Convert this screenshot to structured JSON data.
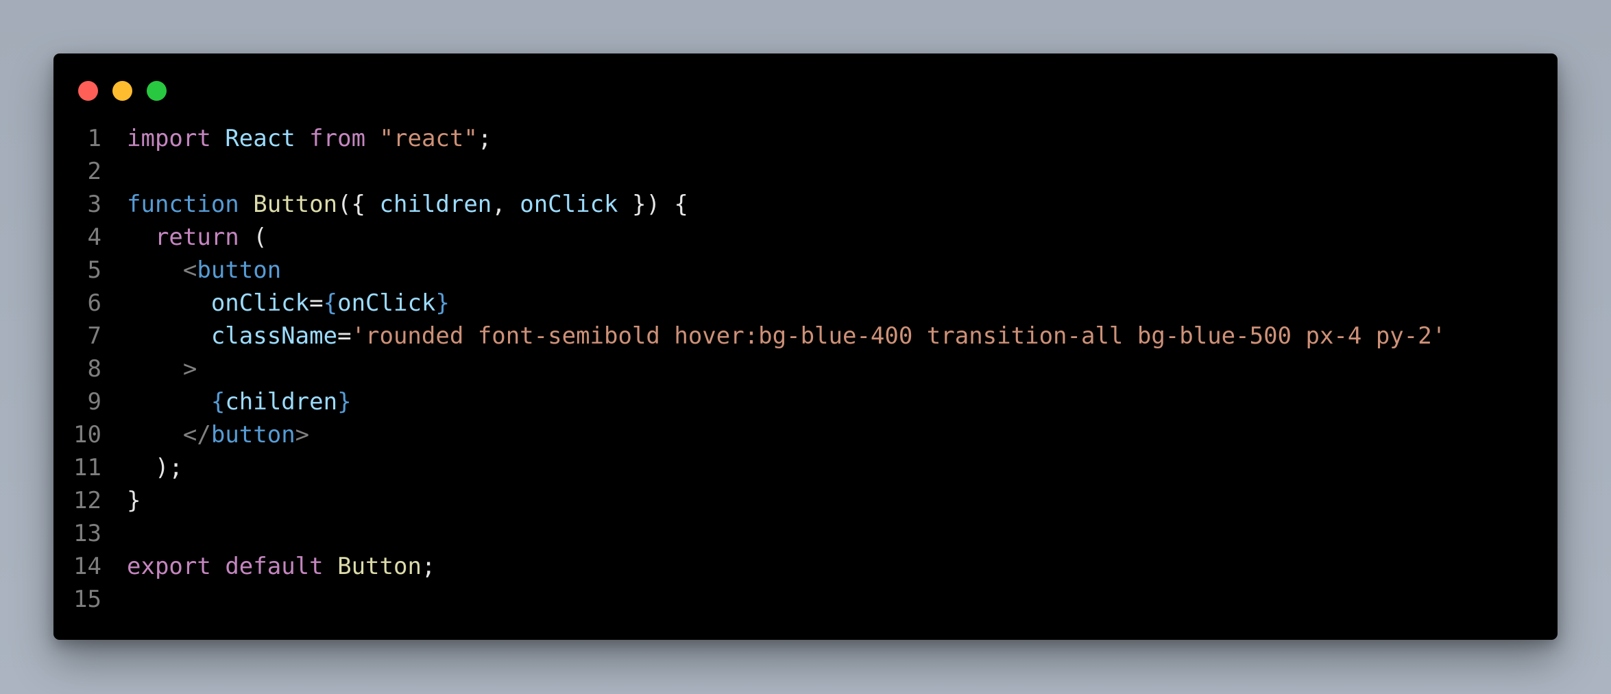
{
  "window": {
    "controls": [
      {
        "name": "close",
        "color": "#ff5f57"
      },
      {
        "name": "minimize",
        "color": "#febc2e"
      },
      {
        "name": "maximize",
        "color": "#28c840"
      }
    ]
  },
  "theme": {
    "background": "#000000",
    "plain": "#e6e6e6",
    "line_number": "#7e7e7e",
    "keyword": "#c586c0",
    "storage": "#569cd6",
    "function_name": "#dcdcaa",
    "variable": "#9cdcfe",
    "string": "#ce9178",
    "tag": "#569cd6",
    "punctuation_dim": "#808080"
  },
  "code_lines": [
    {
      "number": "1",
      "tokens": [
        {
          "text": "import",
          "kind": "keyword"
        },
        {
          "text": " ",
          "kind": "plain"
        },
        {
          "text": "React",
          "kind": "variable"
        },
        {
          "text": " ",
          "kind": "plain"
        },
        {
          "text": "from",
          "kind": "keyword"
        },
        {
          "text": " ",
          "kind": "plain"
        },
        {
          "text": "\"react\"",
          "kind": "string"
        },
        {
          "text": ";",
          "kind": "plain"
        }
      ]
    },
    {
      "number": "2",
      "tokens": []
    },
    {
      "number": "3",
      "tokens": [
        {
          "text": "function",
          "kind": "storage"
        },
        {
          "text": " ",
          "kind": "plain"
        },
        {
          "text": "Button",
          "kind": "function_name"
        },
        {
          "text": "({ ",
          "kind": "plain"
        },
        {
          "text": "children",
          "kind": "variable"
        },
        {
          "text": ", ",
          "kind": "plain"
        },
        {
          "text": "onClick",
          "kind": "variable"
        },
        {
          "text": " }) {",
          "kind": "plain"
        }
      ]
    },
    {
      "number": "4",
      "tokens": [
        {
          "text": "  ",
          "kind": "plain"
        },
        {
          "text": "return",
          "kind": "keyword"
        },
        {
          "text": " (",
          "kind": "plain"
        }
      ]
    },
    {
      "number": "5",
      "tokens": [
        {
          "text": "    ",
          "kind": "plain"
        },
        {
          "text": "<",
          "kind": "punctuation_dim"
        },
        {
          "text": "button",
          "kind": "tag"
        }
      ]
    },
    {
      "number": "6",
      "tokens": [
        {
          "text": "      ",
          "kind": "plain"
        },
        {
          "text": "onClick",
          "kind": "variable"
        },
        {
          "text": "=",
          "kind": "plain"
        },
        {
          "text": "{",
          "kind": "storage"
        },
        {
          "text": "onClick",
          "kind": "variable"
        },
        {
          "text": "}",
          "kind": "storage"
        }
      ]
    },
    {
      "number": "7",
      "tokens": [
        {
          "text": "      ",
          "kind": "plain"
        },
        {
          "text": "className",
          "kind": "variable"
        },
        {
          "text": "=",
          "kind": "plain"
        },
        {
          "text": "'rounded font-semibold hover:bg-blue-400 transition-all bg-blue-500 px-4 py-2'",
          "kind": "string"
        }
      ]
    },
    {
      "number": "8",
      "tokens": [
        {
          "text": "    ",
          "kind": "plain"
        },
        {
          "text": ">",
          "kind": "punctuation_dim"
        }
      ]
    },
    {
      "number": "9",
      "tokens": [
        {
          "text": "      ",
          "kind": "plain"
        },
        {
          "text": "{",
          "kind": "storage"
        },
        {
          "text": "children",
          "kind": "variable"
        },
        {
          "text": "}",
          "kind": "storage"
        }
      ]
    },
    {
      "number": "10",
      "tokens": [
        {
          "text": "    ",
          "kind": "plain"
        },
        {
          "text": "</",
          "kind": "punctuation_dim"
        },
        {
          "text": "button",
          "kind": "tag"
        },
        {
          "text": ">",
          "kind": "punctuation_dim"
        }
      ]
    },
    {
      "number": "11",
      "tokens": [
        {
          "text": "  );",
          "kind": "plain"
        }
      ]
    },
    {
      "number": "12",
      "tokens": [
        {
          "text": "}",
          "kind": "plain"
        }
      ]
    },
    {
      "number": "13",
      "tokens": []
    },
    {
      "number": "14",
      "tokens": [
        {
          "text": "export",
          "kind": "keyword"
        },
        {
          "text": " ",
          "kind": "plain"
        },
        {
          "text": "default",
          "kind": "keyword"
        },
        {
          "text": " ",
          "kind": "plain"
        },
        {
          "text": "Button",
          "kind": "function_name"
        },
        {
          "text": ";",
          "kind": "plain"
        }
      ]
    },
    {
      "number": "15",
      "tokens": []
    }
  ]
}
